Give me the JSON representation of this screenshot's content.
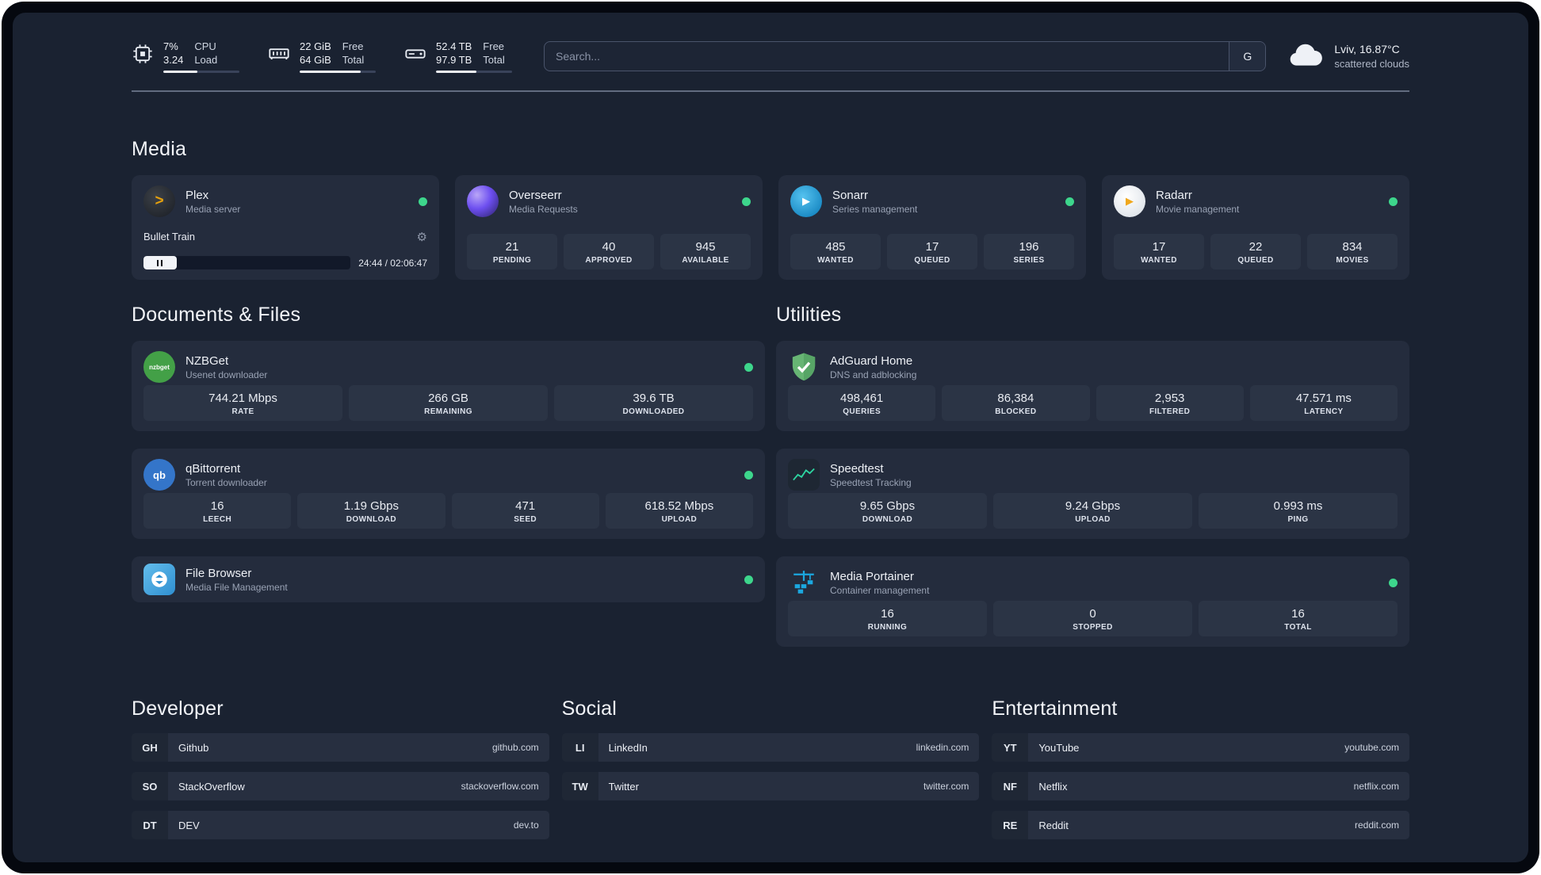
{
  "topbar": {
    "cpu": {
      "value_top": "7%",
      "value_bottom": "3.24",
      "label_top": "CPU",
      "label_bottom": "Load",
      "bar_style": "width:45%"
    },
    "ram": {
      "value_top": "22 GiB",
      "value_bottom": "64 GiB",
      "label_top": "Free",
      "label_bottom": "Total",
      "bar_style": "width:80%"
    },
    "disk": {
      "value_top": "52.4 TB",
      "value_bottom": "97.9 TB",
      "label_top": "Free",
      "label_bottom": "Total",
      "bar_style": "width:53%"
    },
    "search": {
      "placeholder": "Search...",
      "button_label": "G"
    },
    "weather": {
      "location": "Lviv, 16.87°C",
      "condition": "scattered clouds"
    }
  },
  "sections": {
    "media": "Media",
    "documents": "Documents & Files",
    "utilities": "Utilities",
    "developer": "Developer",
    "social": "Social",
    "entertainment": "Entertainment"
  },
  "icons": {
    "plex_glyph": ">",
    "sonarr_glyph": "▶",
    "radarr_glyph": "▶",
    "gear_glyph": "⚙",
    "nzbget_text": "nzbget",
    "qbittorrent_text": "qb"
  },
  "media": {
    "plex": {
      "title": "Plex",
      "subtitle": "Media server",
      "now_playing": "Bullet Train",
      "time": "24:44 / 02:06:47",
      "progress_style": "width:16%"
    },
    "overseerr": {
      "title": "Overseerr",
      "subtitle": "Media Requests",
      "stats": [
        {
          "value": "21",
          "label": "PENDING"
        },
        {
          "value": "40",
          "label": "APPROVED"
        },
        {
          "value": "945",
          "label": "AVAILABLE"
        }
      ]
    },
    "sonarr": {
      "title": "Sonarr",
      "subtitle": "Series management",
      "stats": [
        {
          "value": "485",
          "label": "WANTED"
        },
        {
          "value": "17",
          "label": "QUEUED"
        },
        {
          "value": "196",
          "label": "SERIES"
        }
      ]
    },
    "radarr": {
      "title": "Radarr",
      "subtitle": "Movie management",
      "stats": [
        {
          "value": "17",
          "label": "WANTED"
        },
        {
          "value": "22",
          "label": "QUEUED"
        },
        {
          "value": "834",
          "label": "MOVIES"
        }
      ]
    }
  },
  "documents": {
    "nzbget": {
      "title": "NZBGet",
      "subtitle": "Usenet downloader",
      "stats": [
        {
          "value": "744.21 Mbps",
          "label": "RATE"
        },
        {
          "value": "266 GB",
          "label": "REMAINING"
        },
        {
          "value": "39.6 TB",
          "label": "DOWNLOADED"
        }
      ]
    },
    "qbittorrent": {
      "title": "qBittorrent",
      "subtitle": "Torrent downloader",
      "stats": [
        {
          "value": "16",
          "label": "LEECH"
        },
        {
          "value": "1.19 Gbps",
          "label": "DOWNLOAD"
        },
        {
          "value": "471",
          "label": "SEED"
        },
        {
          "value": "618.52 Mbps",
          "label": "UPLOAD"
        }
      ]
    },
    "filebrowser": {
      "title": "File Browser",
      "subtitle": "Media File Management"
    }
  },
  "utilities": {
    "adguard": {
      "title": "AdGuard Home",
      "subtitle": "DNS and adblocking",
      "stats": [
        {
          "value": "498,461",
          "label": "QUERIES"
        },
        {
          "value": "86,384",
          "label": "BLOCKED"
        },
        {
          "value": "2,953",
          "label": "FILTERED"
        },
        {
          "value": "47.571 ms",
          "label": "LATENCY"
        }
      ]
    },
    "speedtest": {
      "title": "Speedtest",
      "subtitle": "Speedtest Tracking",
      "stats": [
        {
          "value": "9.65 Gbps",
          "label": "DOWNLOAD"
        },
        {
          "value": "9.24 Gbps",
          "label": "UPLOAD"
        },
        {
          "value": "0.993 ms",
          "label": "PING"
        }
      ]
    },
    "portainer": {
      "title": "Media Portainer",
      "subtitle": "Container management",
      "stats": [
        {
          "value": "16",
          "label": "RUNNING"
        },
        {
          "value": "0",
          "label": "STOPPED"
        },
        {
          "value": "16",
          "label": "TOTAL"
        }
      ]
    }
  },
  "bookmarks": {
    "developer": [
      {
        "abbr": "GH",
        "name": "Github",
        "url": "github.com"
      },
      {
        "abbr": "SO",
        "name": "StackOverflow",
        "url": "stackoverflow.com"
      },
      {
        "abbr": "DT",
        "name": "DEV",
        "url": "dev.to"
      }
    ],
    "social": [
      {
        "abbr": "LI",
        "name": "LinkedIn",
        "url": "linkedin.com"
      },
      {
        "abbr": "TW",
        "name": "Twitter",
        "url": "twitter.com"
      }
    ],
    "entertainment": [
      {
        "abbr": "YT",
        "name": "YouTube",
        "url": "youtube.com"
      },
      {
        "abbr": "NF",
        "name": "Netflix",
        "url": "netflix.com"
      },
      {
        "abbr": "RE",
        "name": "Reddit",
        "url": "reddit.com"
      }
    ]
  },
  "colors": {
    "status_ok": "#3dd68c",
    "background": "#1a2231",
    "card": "#242c3d",
    "stat_box": "#2b3445",
    "plex_accent": "#e5a00d"
  }
}
